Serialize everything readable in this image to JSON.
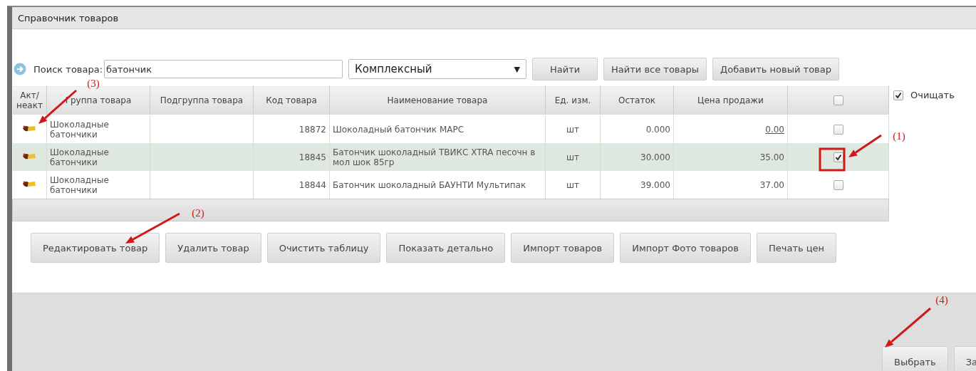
{
  "window": {
    "title": "Справочник товаров"
  },
  "search": {
    "label": "Поиск товара:",
    "value": "батончик",
    "mode": "Комплексный",
    "mode_caret": "▼",
    "buttons": [
      "Найти",
      "Найти все товары",
      "Добавить новый товар"
    ]
  },
  "table": {
    "columns": [
      "Акт/ неакт",
      "Группа товара",
      "Подгруппа товара",
      "Код товара",
      "Наименование товара",
      "Ед. изм.",
      "Остаток",
      "Цена продажи"
    ],
    "select_all": false,
    "rows": [
      {
        "group": "Шоколадные батончики",
        "code": "18872",
        "name": "Шоколадный батончик МАРС",
        "unit": "шт",
        "stock": "0.000",
        "price": "0.00",
        "price_link": true,
        "checked": false
      },
      {
        "group": "Шоколадные батончики",
        "code": "18845",
        "name": "Батончик шоколадный ТВИКС XTRA песочн в мол шок 85гр",
        "unit": "шт",
        "stock": "30.000",
        "price": "35.00",
        "price_link": false,
        "checked": true
      },
      {
        "group": "Шоколадные батончики",
        "code": "18844",
        "name": "Батончик шоколадный БАУНТИ Мультипак",
        "unit": "шт",
        "stock": "39.000",
        "price": "37.00",
        "price_link": false,
        "checked": false
      }
    ]
  },
  "clear_option": {
    "label": "Очищать",
    "checked": true
  },
  "actions": [
    "Редактировать товар",
    "Удалить товар",
    "Очистить таблицу",
    "Показать детально",
    "Импорт товаров",
    "Импорт Фото товаров",
    "Печать цен"
  ],
  "footer_buttons": [
    "Выбрать",
    "За"
  ],
  "annotations": [
    {
      "label": "(3)"
    },
    {
      "label": "(1)"
    },
    {
      "label": "(2)"
    },
    {
      "label": "(4)"
    }
  ]
}
